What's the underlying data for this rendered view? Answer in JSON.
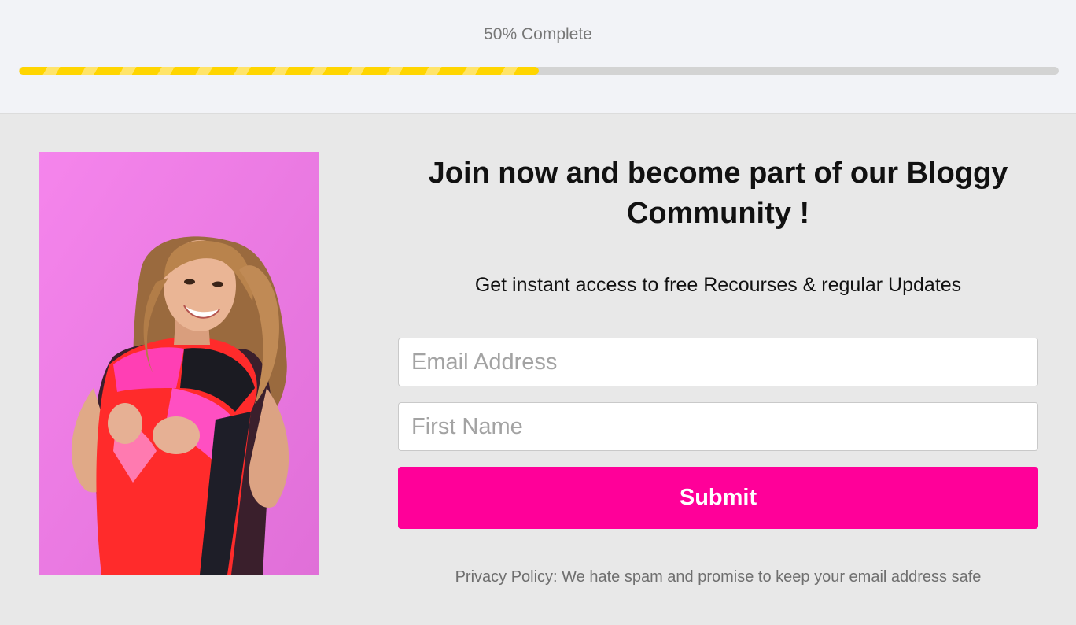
{
  "progress": {
    "label": "50% Complete",
    "value": 0.5
  },
  "hero": {
    "image_icon": "person-photo"
  },
  "form": {
    "headline": "Join now and become part of our Bloggy Community !",
    "subheadline": "Get instant access to free Recourses & regular Updates",
    "email_placeholder": "Email Address",
    "email_value": "",
    "first_name_placeholder": "First Name",
    "first_name_value": "",
    "submit_label": "Submit",
    "privacy_text": "Privacy Policy: We hate spam and promise to keep your email address safe"
  },
  "colors": {
    "progress_fill": "#ffd500",
    "submit_bg": "#ff0099",
    "photo_bg": "#f07ce6"
  }
}
